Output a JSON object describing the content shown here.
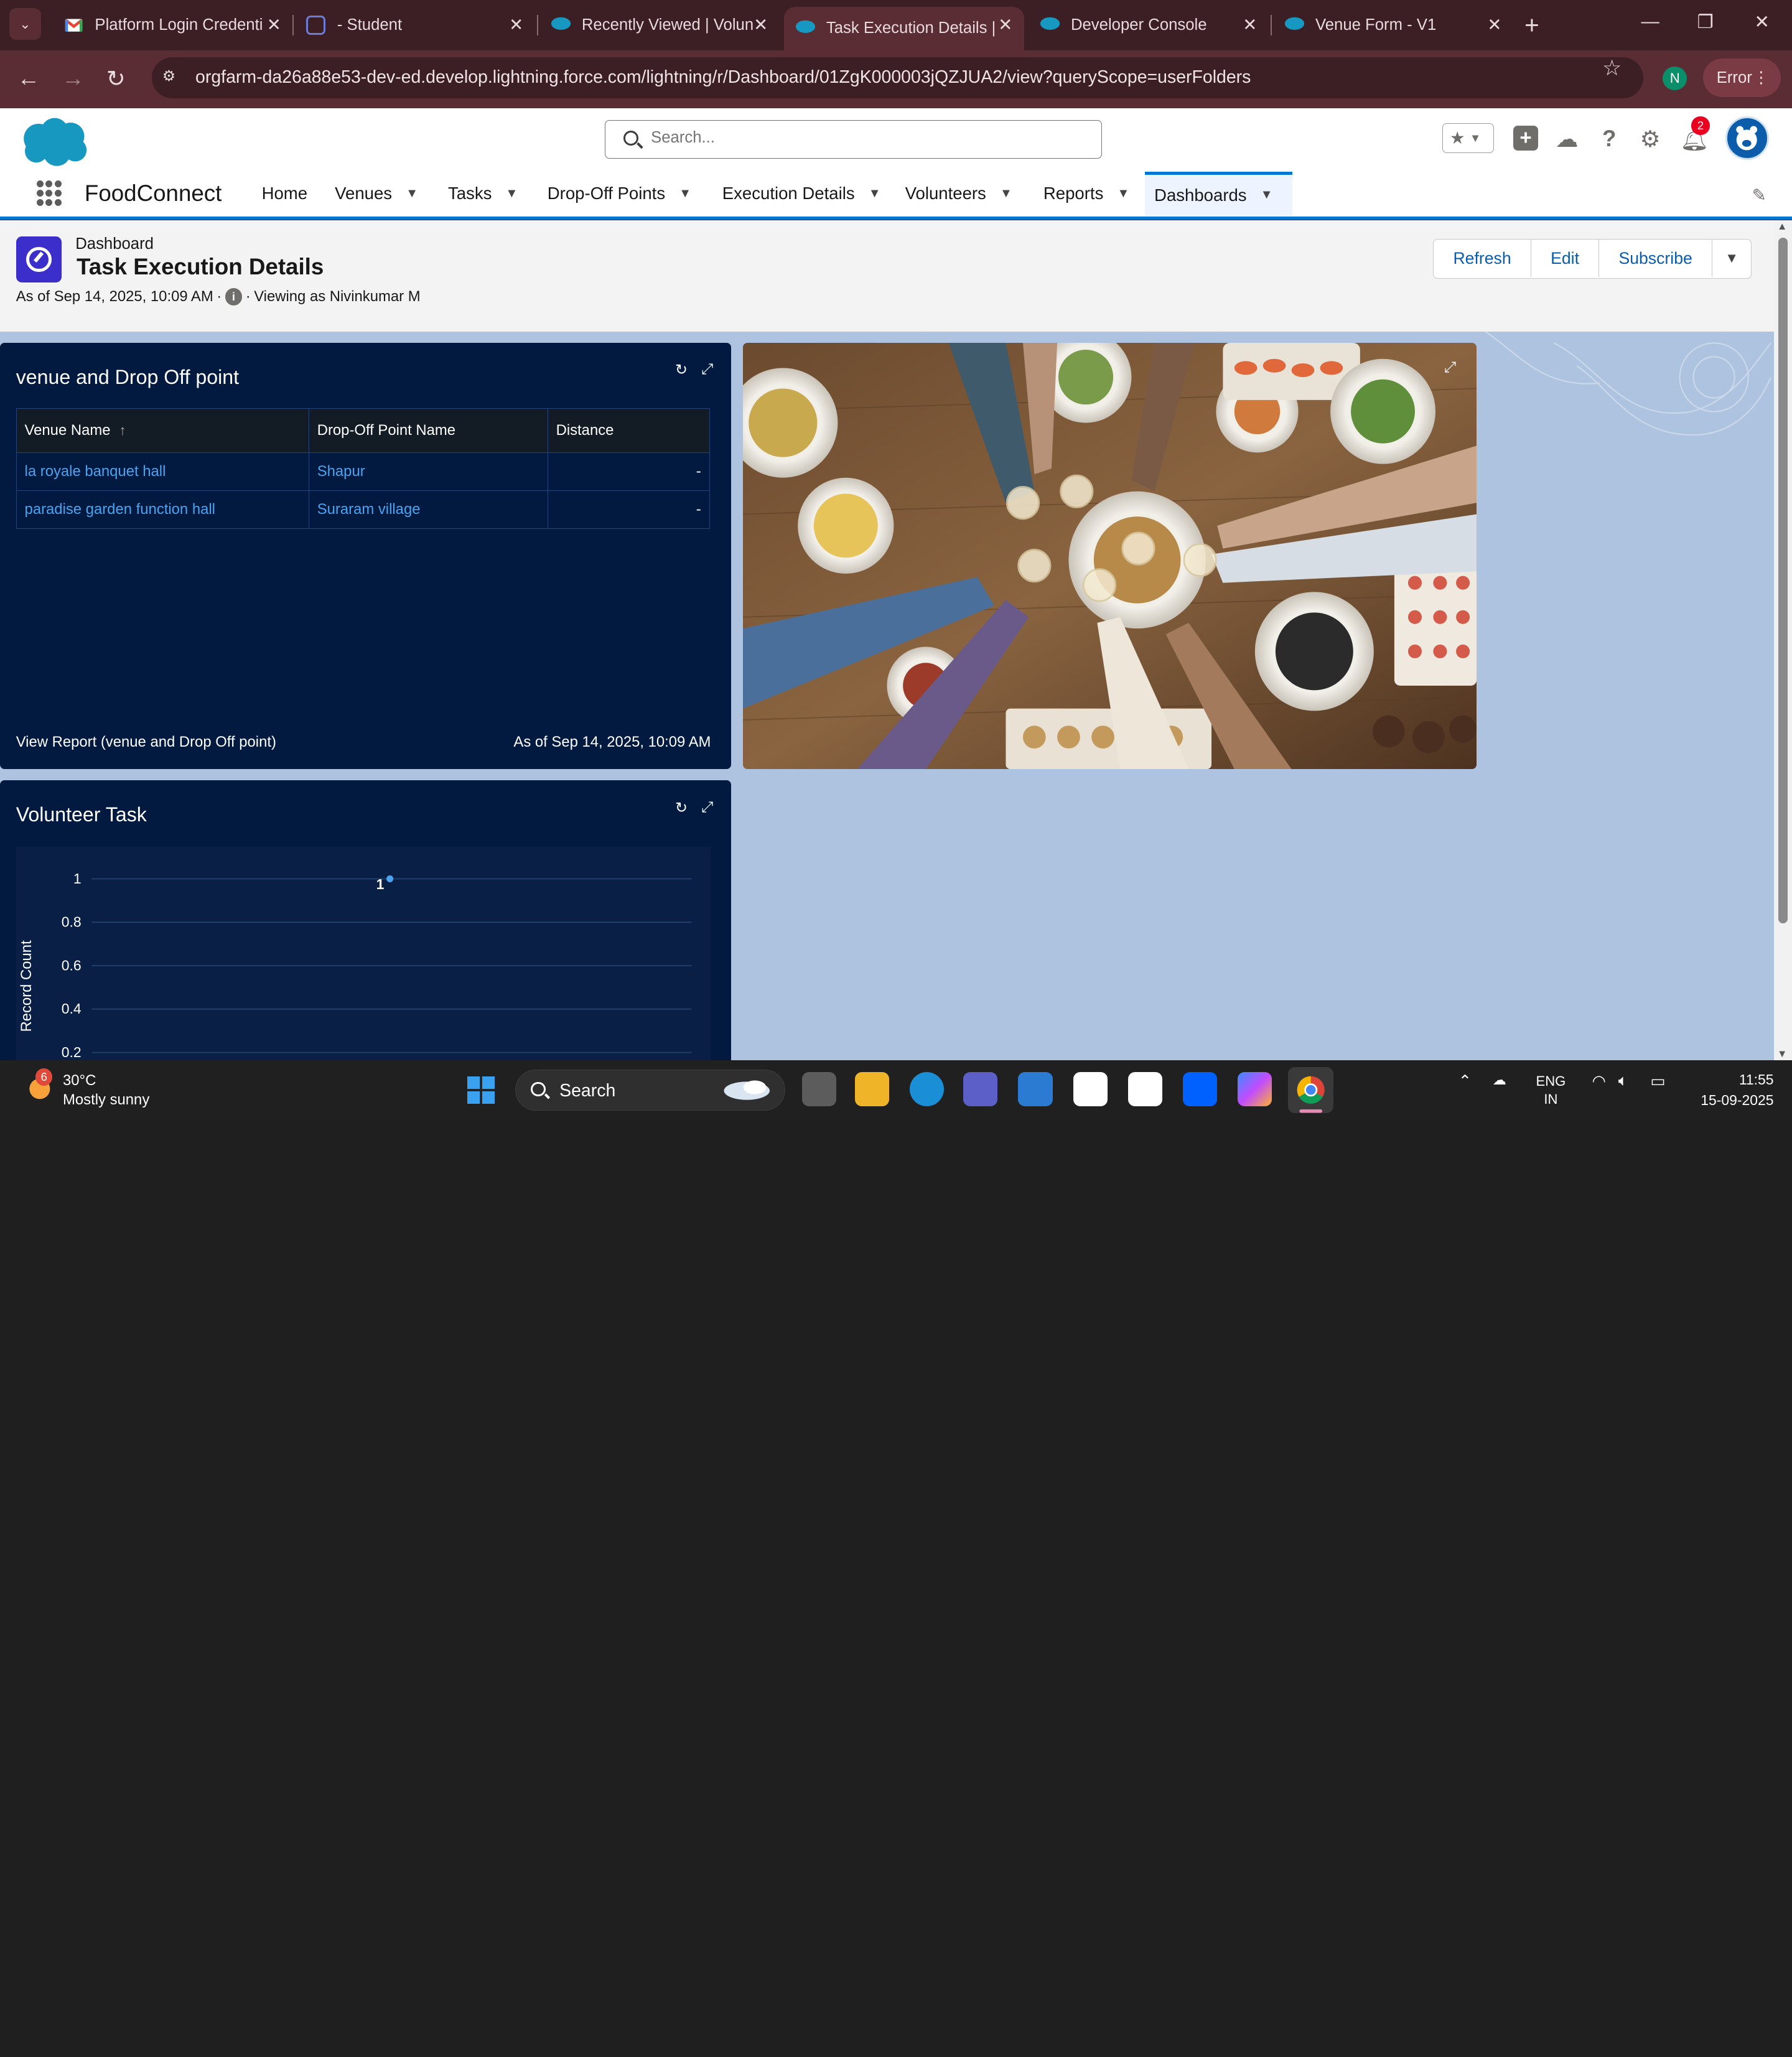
{
  "browser": {
    "tabs": [
      {
        "title": "Platform Login Credenti",
        "favicon": "gmail-icon"
      },
      {
        "title": "- Student",
        "favicon": "student-icon"
      },
      {
        "title": "Recently Viewed | Volun",
        "favicon": "salesforce-icon"
      },
      {
        "title": "Task Execution Details |",
        "favicon": "salesforce-icon",
        "active": true
      },
      {
        "title": "Developer Console",
        "favicon": "salesforce-icon"
      },
      {
        "title": "Venue Form - V1",
        "favicon": "salesforce-icon"
      }
    ],
    "url": "orgfarm-da26a88e53-dev-ed.develop.lightning.force.com/lightning/r/Dashboard/01ZgK000003jQZJUA2/view?queryScope=userFolders",
    "profile_initial": "N",
    "error_label": "Error"
  },
  "sf_header": {
    "search_placeholder": "Search...",
    "notification_count": "2"
  },
  "nav": {
    "app_name": "FoodConnect",
    "items": [
      {
        "label": "Home",
        "has_menu": false
      },
      {
        "label": "Venues",
        "has_menu": true
      },
      {
        "label": "Tasks",
        "has_menu": true
      },
      {
        "label": "Drop-Off Points",
        "has_menu": true
      },
      {
        "label": "Execution Details",
        "has_menu": true
      },
      {
        "label": "Volunteers",
        "has_menu": true
      },
      {
        "label": "Reports",
        "has_menu": true
      },
      {
        "label": "Dashboards",
        "has_menu": true,
        "active": true
      }
    ]
  },
  "dashboard": {
    "object_label": "Dashboard",
    "title": "Task Execution Details",
    "as_of": "As of Sep 14, 2025, 10:09 AM",
    "viewing_as": "Viewing as Nivinkumar M",
    "buttons": {
      "refresh": "Refresh",
      "edit": "Edit",
      "subscribe": "Subscribe"
    }
  },
  "widget_table": {
    "title": "venue and Drop Off point",
    "columns": [
      "Venue Name",
      "Drop-Off Point Name",
      "Distance"
    ],
    "sort_indicator": "↑",
    "rows": [
      [
        "la royale banquet hall",
        "Shapur",
        "-"
      ],
      [
        "paradise garden function hall",
        "Suraram village",
        "-"
      ]
    ],
    "footer_link": "View Report (venue and Drop Off point)",
    "footer_asof": "As of Sep 14, 2025, 10:09 AM"
  },
  "widget_chart": {
    "title": "Volunteer Task"
  },
  "chart_data": {
    "type": "scatter",
    "title": "Volunteer Task",
    "xlabel": "",
    "ylabel": "Record Count",
    "yticks": [
      "1",
      "0.8",
      "0.6",
      "0.4",
      "0.2"
    ],
    "ylim": [
      0,
      1
    ],
    "grid": true,
    "series": [
      {
        "values": [
          1
        ],
        "data_labels": [
          "1"
        ]
      }
    ],
    "colors": {
      "point": "#4aa3f0",
      "background": "#0a1f45",
      "grid": "#24406c"
    }
  },
  "taskbar": {
    "weather_temp": "30°C",
    "weather_desc": "Mostly sunny",
    "weather_badge": "6",
    "search_label": "Search",
    "lang_line1": "ENG",
    "lang_line2": "IN",
    "time": "11:55",
    "date": "15-09-2025"
  },
  "colors": {
    "brand": "#0176d3",
    "tab_strip": "#3c1f24",
    "toolbar": "#5a2c33",
    "widget_bg": "#021a3f",
    "canvas_bg": "#aec3df"
  }
}
